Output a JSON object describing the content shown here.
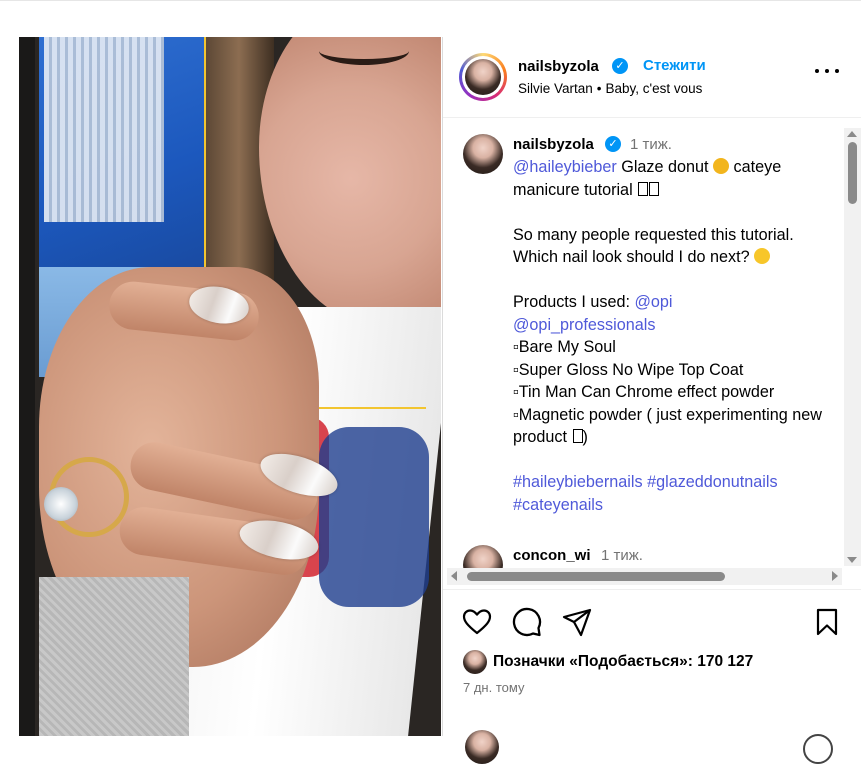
{
  "post": {
    "author": "nailsbyzola",
    "follow_label": "Стежити",
    "audio_artist": "Silvie Vartan",
    "audio_separator": "•",
    "audio_track": "Baby, c'est vous",
    "more_icon": "more-horizontal-icon"
  },
  "caption": {
    "username": "nailsbyzola",
    "time": "1 тиж.",
    "line1_mention": "@haileybieber",
    "line1_text_a": "Glaze donut",
    "line1_text_b": "cateye manicure tutorial",
    "para2": "So many people requested this tutorial. Which nail look should I do next?",
    "products_label": "Products I used:",
    "products_mention1": "@opi",
    "products_mention2": "@opi_professionals",
    "items": [
      "▫Bare My Soul",
      "▫Super Gloss No Wipe Top Coat",
      "▫Tin Man Can Chrome effect powder",
      "▫Magnetic powder ( just experimenting new product"
    ],
    "item_tail": ")",
    "hashtags": [
      "#haileybiebernails",
      "#glazeddonutnails",
      "#cateyenails"
    ]
  },
  "comment": {
    "username": "concon_wi",
    "time": "1 тиж."
  },
  "actions": {
    "like_icon": "heart-icon",
    "comment_icon": "comment-icon",
    "share_icon": "send-icon",
    "save_icon": "bookmark-icon"
  },
  "likes": {
    "label": "Позначки «Подобається»: 170 127"
  },
  "date": "7 дн. тому",
  "colors": {
    "link": "#4f59d9",
    "follow": "#0095f6",
    "verified": "#0095f6",
    "muted": "#737373"
  }
}
